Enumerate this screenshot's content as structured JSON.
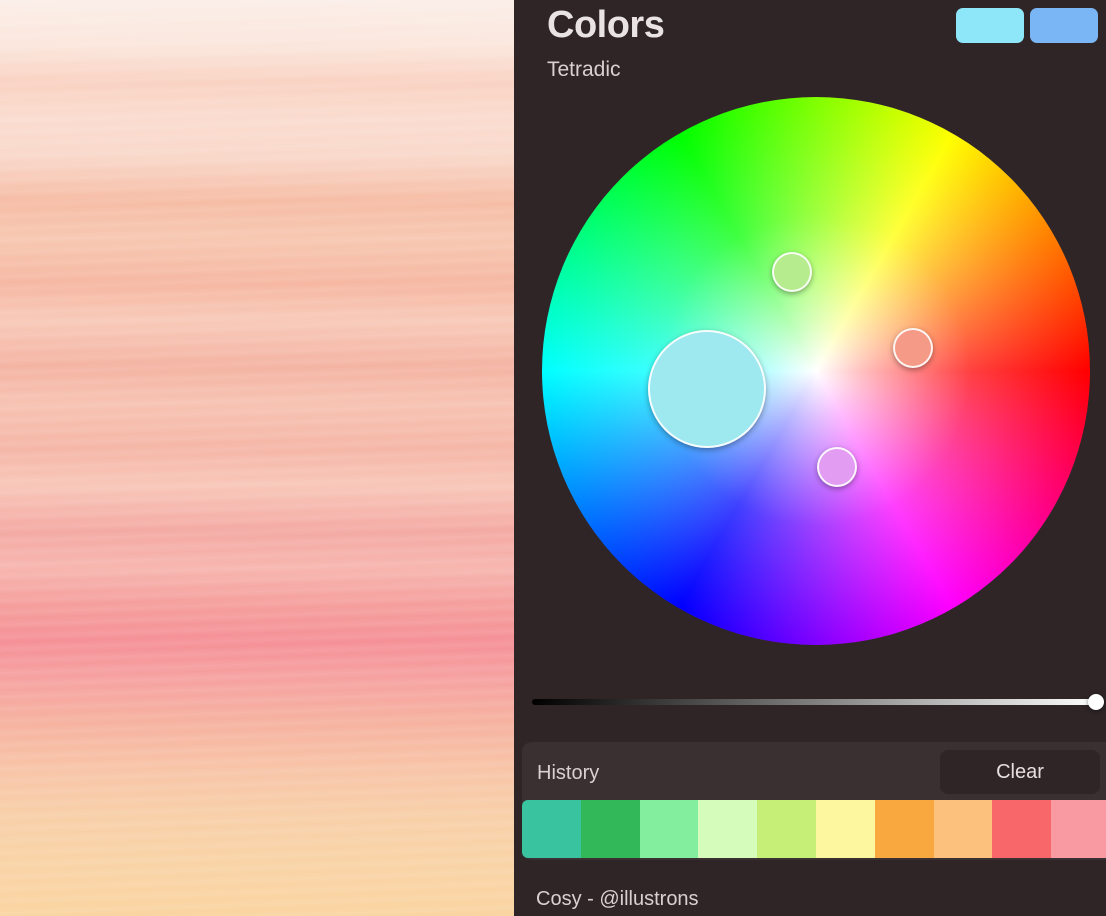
{
  "colors_panel": {
    "title": "Colors",
    "mode": "Tetradic",
    "current_color": "#8ee7f8",
    "previous_color": "#7ab6f5"
  },
  "harmony_points": [
    {
      "color": "#9ee8ef",
      "role": "primary"
    },
    {
      "color": "#b6ec8e",
      "role": "secondary"
    },
    {
      "color": "#f59a86",
      "role": "secondary"
    },
    {
      "color": "#e29cf2",
      "role": "secondary"
    }
  ],
  "brightness": {
    "value": 1.0
  },
  "history": {
    "label": "History",
    "clear_label": "Clear",
    "colors": [
      "#39c39e",
      "#33b859",
      "#83ef9e",
      "#d5fcbb",
      "#c6ef78",
      "#fdf8a0",
      "#f9a840",
      "#fcc27d",
      "#f8676a",
      "#f99aa2"
    ]
  },
  "palette": {
    "name": "Cosy - @illustrons"
  }
}
